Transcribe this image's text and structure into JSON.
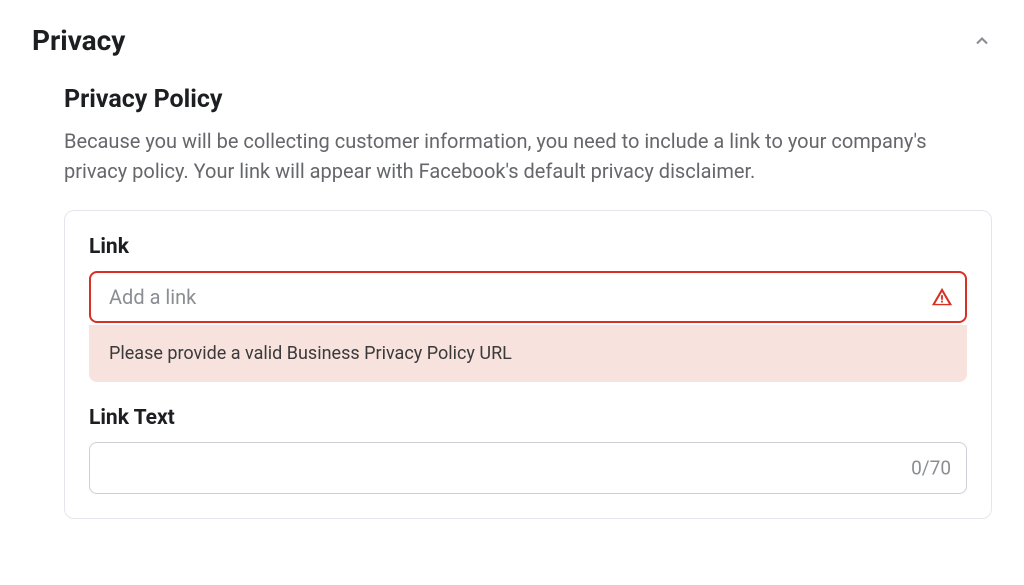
{
  "section": {
    "title": "Privacy"
  },
  "subsection": {
    "title": "Privacy Policy",
    "description": "Because you will be collecting customer information, you need to include a link to your company's privacy policy. Your link will appear with Facebook's default privacy disclaimer."
  },
  "fields": {
    "link": {
      "label": "Link",
      "placeholder": "Add a link",
      "error_message": "Please provide a valid Business Privacy Policy URL"
    },
    "link_text": {
      "label": "Link Text",
      "char_count": "0/70"
    }
  }
}
